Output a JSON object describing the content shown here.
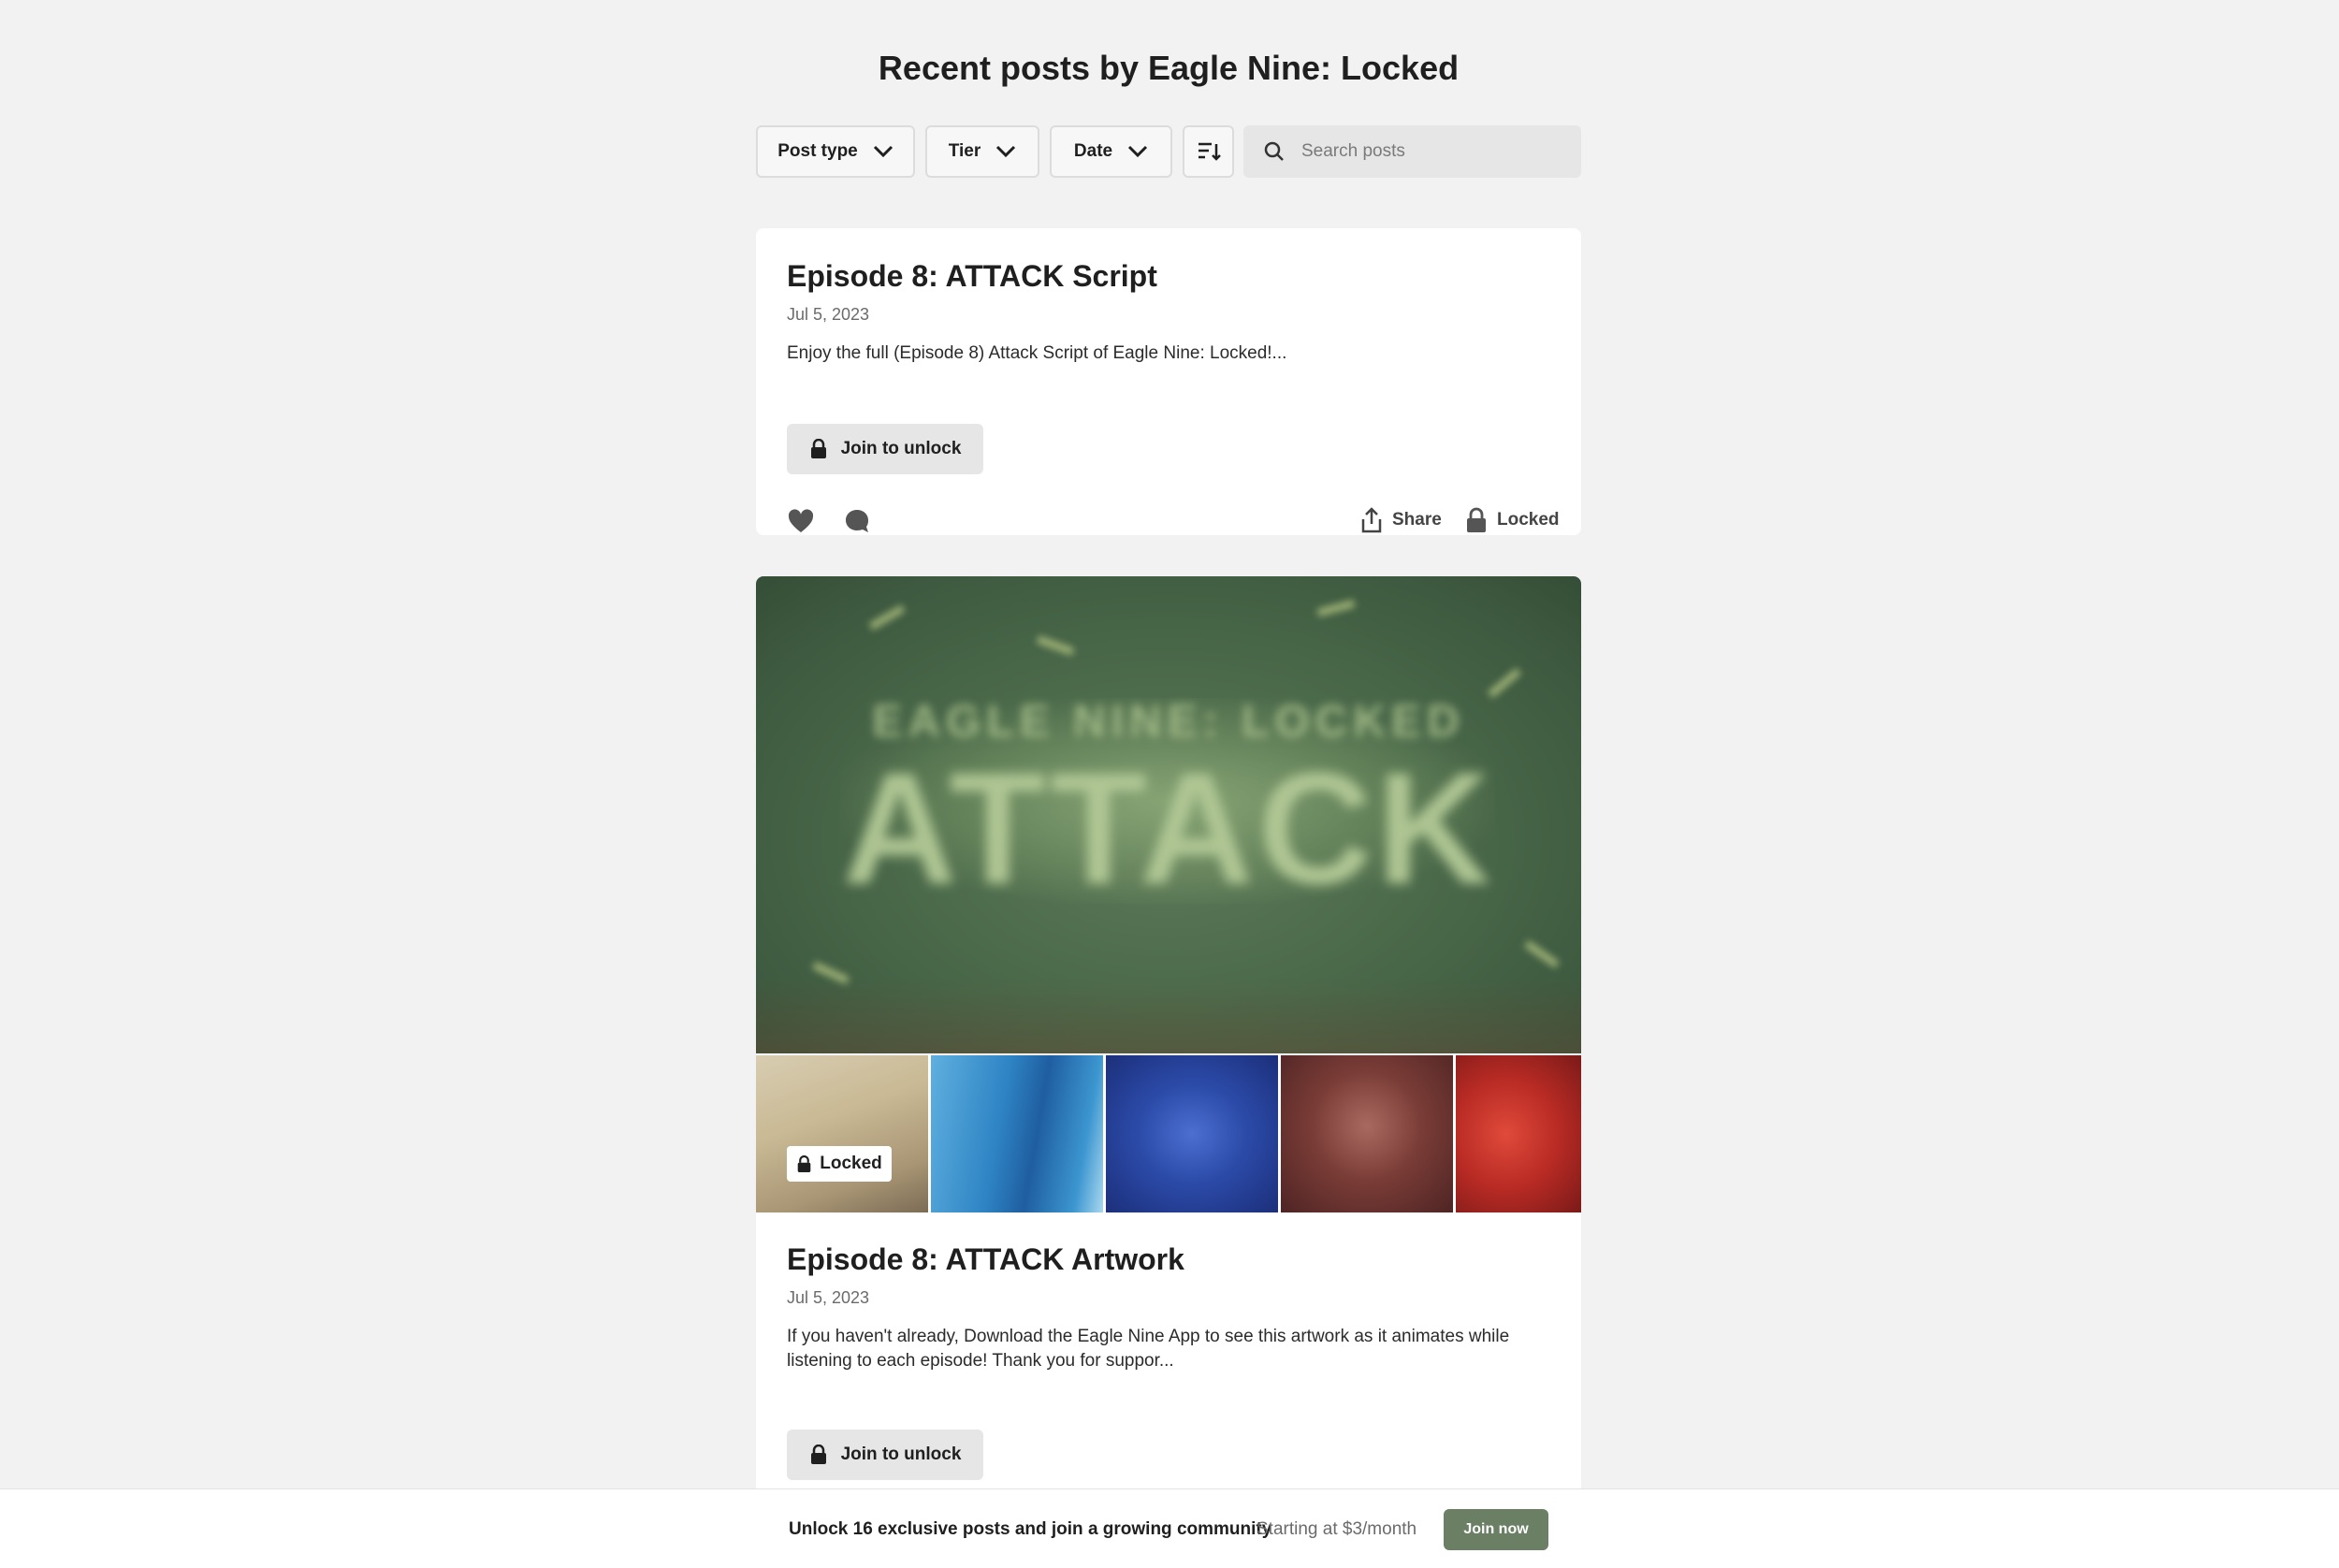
{
  "page": {
    "title": "Recent posts by Eagle Nine: Locked"
  },
  "filters": {
    "post_type": "Post type",
    "tier": "Tier",
    "date": "Date",
    "sort_icon": "sort-icon",
    "search_placeholder": "Search posts"
  },
  "posts": [
    {
      "title": "Episode 8: ATTACK Script",
      "date": "Jul 5, 2023",
      "excerpt": "Enjoy the full (Episode 8) Attack Script of Eagle Nine: Locked!...",
      "unlock_label": "Join to unlock",
      "share_label": "Share",
      "locked_label": "Locked"
    },
    {
      "title": "Episode 8: ATTACK Artwork",
      "date": "Jul 5, 2023",
      "excerpt": "If you haven't already, Download the Eagle Nine App to see this artwork as it animates while listening to each episode! Thank you for suppor...",
      "unlock_label": "Join to unlock",
      "gallery_locked_label": "Locked",
      "hero_text_small": "EAGLE NINE: LOCKED",
      "hero_text_big": "ATTACK"
    }
  ],
  "footer": {
    "text": "Unlock 16 exclusive posts and join a growing community",
    "price": "Starting at $3/month",
    "join_label": "Join now"
  },
  "colors": {
    "background": "#f2f2f2",
    "accent": "#6a7f64",
    "hero_green": "#4b6a4a"
  }
}
